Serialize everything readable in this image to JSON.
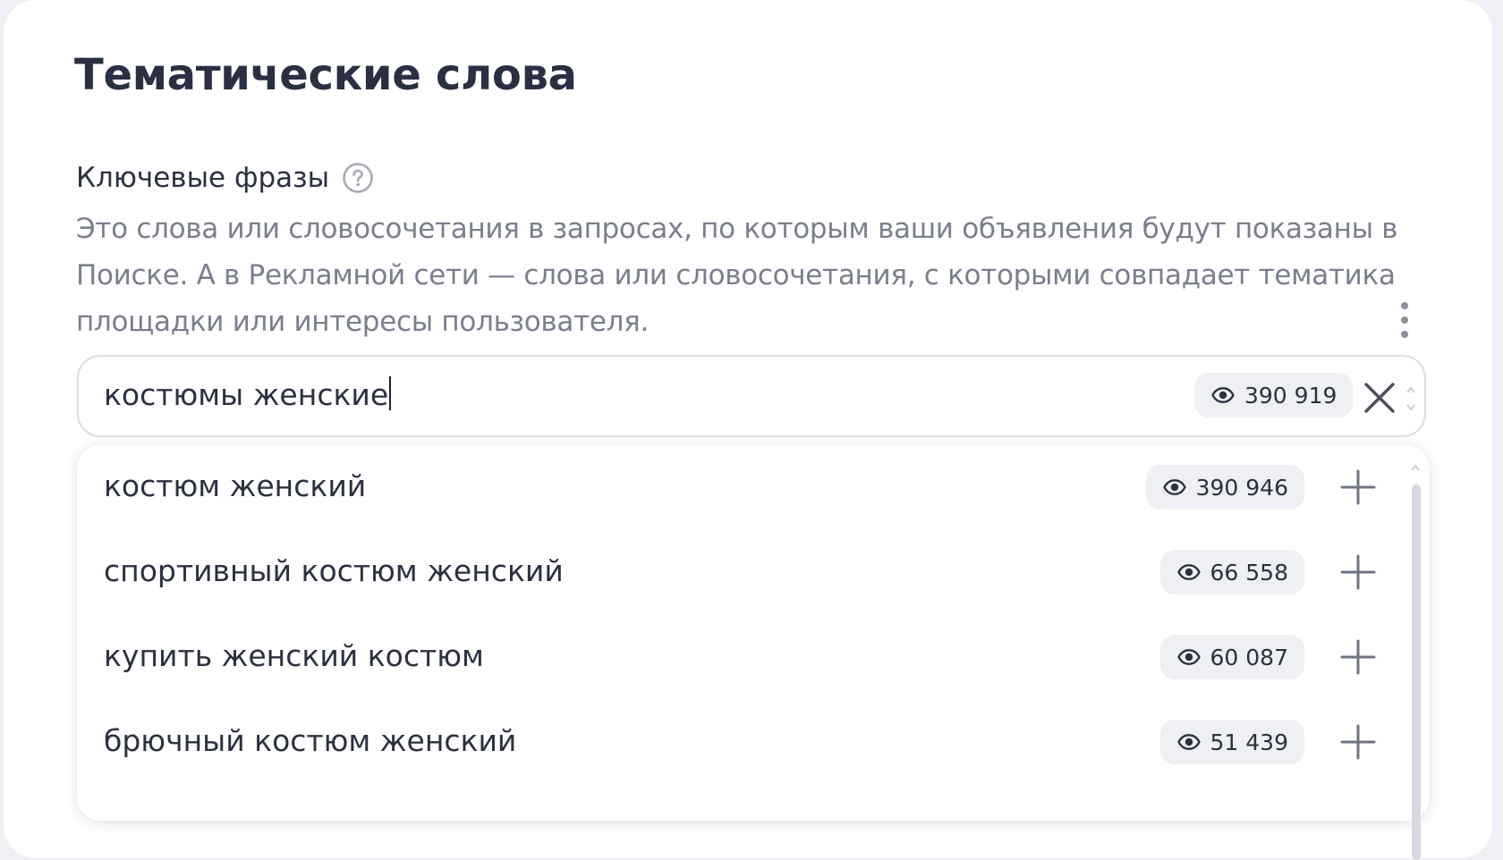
{
  "section": {
    "title": "Тематические слова"
  },
  "keywords": {
    "label": "Ключевые фразы",
    "help_icon": "question-circle-icon",
    "description": "Это слова или словосочетания в запросах, по которым ваши объявления будут показаны в Поиске. А в Рекламной сети — слова или словосочетания, с которыми совпадает тематика площадки или интересы пользователя.",
    "menu_icon": "kebab-vertical-icon",
    "input": {
      "value": "костюмы женские",
      "shows": "390 919",
      "shows_icon": "eye-icon",
      "clear_icon": "close-icon"
    },
    "suggestions": [
      {
        "text": "костюм женский",
        "shows": "390 946"
      },
      {
        "text": "спортивный костюм женский",
        "shows": "66 558"
      },
      {
        "text": "купить женский костюм",
        "shows": "60 087"
      },
      {
        "text": "брючный костюм женский",
        "shows": "51 439"
      }
    ],
    "add_icon": "plus-icon"
  },
  "colors": {
    "title": "#2a3042",
    "text": "#2c3140",
    "muted": "#7a7f8c",
    "pill_bg": "#eef0f3",
    "border": "#d9dde4"
  }
}
